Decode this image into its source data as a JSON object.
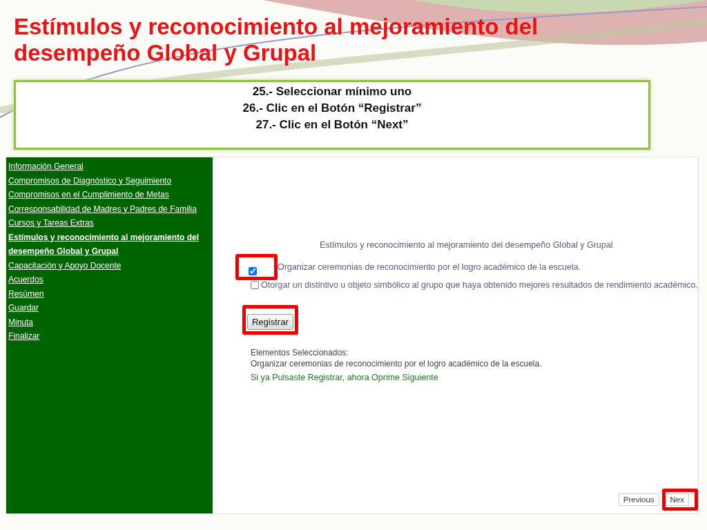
{
  "slide": {
    "title": "Estímulos y reconocimiento al mejoramiento del desempeño Global y Grupal",
    "instructions": [
      "25.- Seleccionar mínimo uno",
      "26.- Clic en el Botón  “Registrar”",
      "27.- Clic en el Botón “Next”"
    ]
  },
  "sidebar": {
    "items": [
      {
        "label": "Información General",
        "selected": false
      },
      {
        "label": "Compromisos de Diagnóstico y Seguimiento",
        "selected": false
      },
      {
        "label": "Compromisos en el Cumplimiento de Metas",
        "selected": false
      },
      {
        "label": "Corresponsabilidad de Madres y Padres de Familia",
        "selected": false
      },
      {
        "label": "Cursos y Tareas Extras",
        "selected": false
      },
      {
        "label": "Estímulos y reconocimiento al mejoramiento del desempeño Global y Grupal",
        "selected": true
      },
      {
        "label": "Capacitación y Apoyo Docente",
        "selected": false
      },
      {
        "label": "Acuerdos",
        "selected": false
      },
      {
        "label": "Resúmen",
        "selected": false
      },
      {
        "label": "Guardar",
        "selected": false
      },
      {
        "label": "Minuta",
        "selected": false
      },
      {
        "label": "Finalizar",
        "selected": false
      }
    ]
  },
  "form": {
    "heading": "Estímulos y reconocimiento al mejoramiento del desempeño Global y Grupal",
    "options": [
      {
        "label": "Organizar ceremonias de reconocimiento por el logro académico de la escuela.",
        "checked": true,
        "highlighted": true
      },
      {
        "label": "Otorgar un distintivo u objeto simbólico al grupo que haya obtenido mejores resultados de rendimiento académico.",
        "checked": false,
        "highlighted": false
      }
    ],
    "register_button": {
      "label": "Registrar",
      "highlighted": true
    },
    "selected_heading": "Elementos Seleccionados:",
    "selected_items": [
      "Organizar ceremonias de reconocimiento por el logro académico de la escuela."
    ],
    "hint": "Si ya Pulsaste Registrar, ahora Oprime Siguiente"
  },
  "nav_buttons": [
    {
      "label": "Previous",
      "highlighted": false
    },
    {
      "label": "Nex",
      "highlighted": true
    }
  ]
}
